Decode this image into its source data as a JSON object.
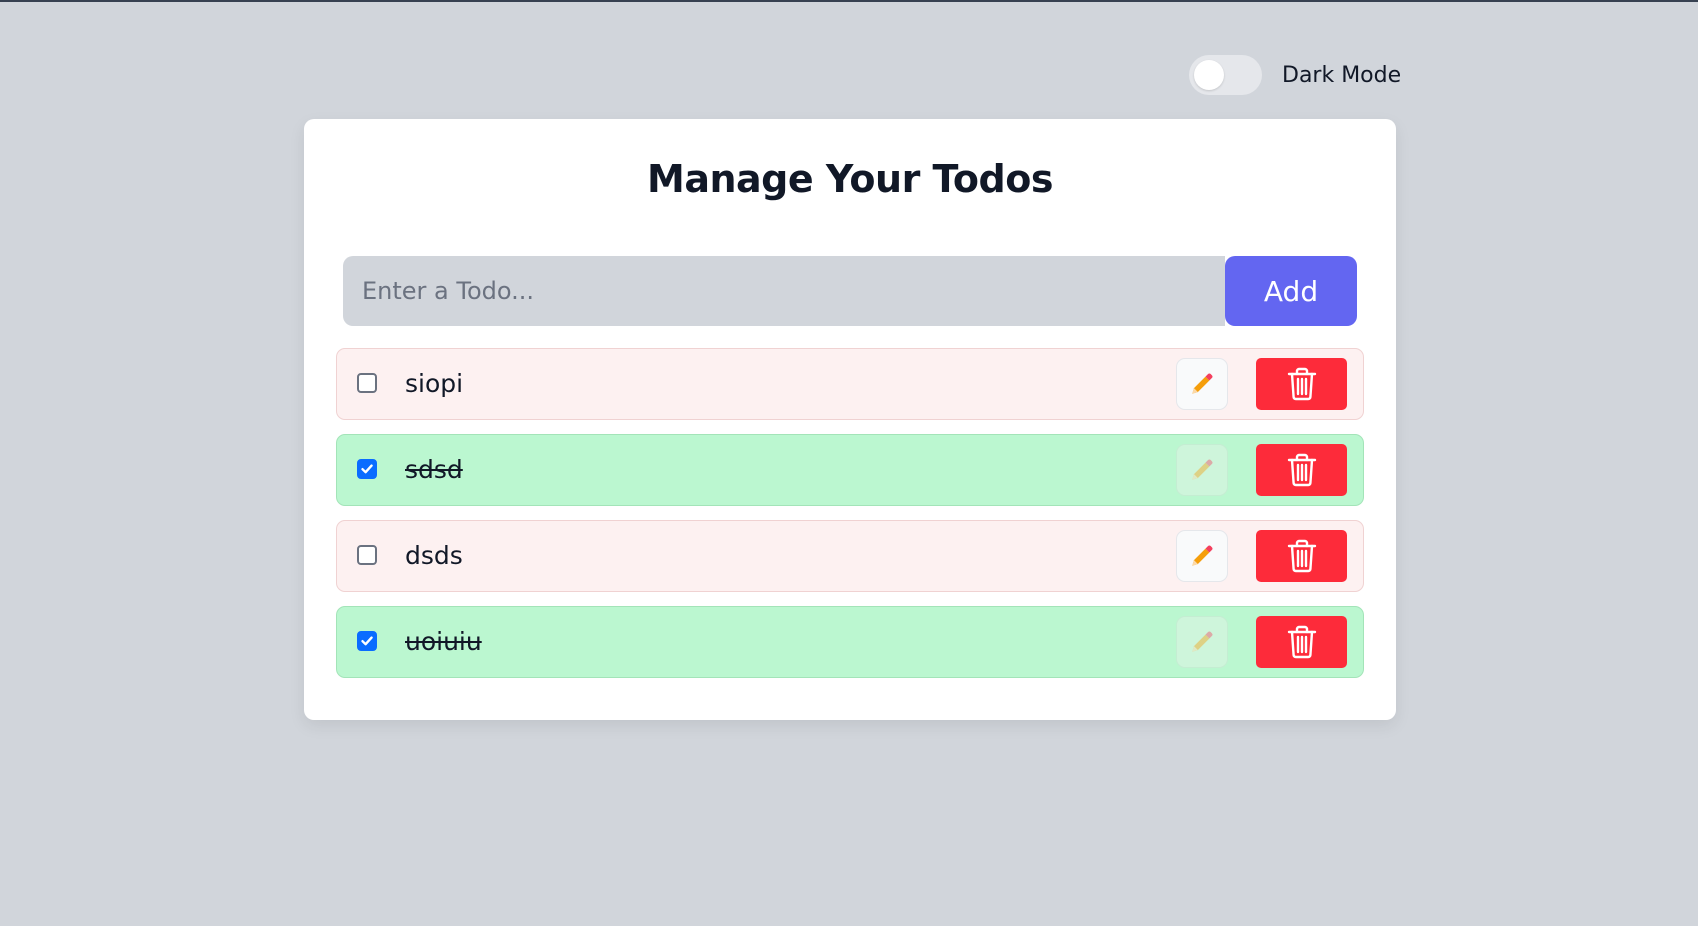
{
  "dark_mode": {
    "label": "Dark Mode",
    "enabled": false
  },
  "title": "Manage Your Todos",
  "input": {
    "placeholder": "Enter a Todo...",
    "value": ""
  },
  "add_button_label": "Add",
  "todos": [
    {
      "text": "siopi",
      "completed": false
    },
    {
      "text": "sdsd",
      "completed": true
    },
    {
      "text": "dsds",
      "completed": false
    },
    {
      "text": "uoiuiu",
      "completed": true
    }
  ],
  "icons": {
    "edit": "pencil-icon",
    "delete": "trash-icon"
  },
  "colors": {
    "page_background": "#d1d5db",
    "accent": "#6366f1",
    "delete": "#fd2b3a",
    "completed_row": "#bbf7d0",
    "pending_row": "#fdf1f1",
    "checkbox_checked": "#0a6cff"
  }
}
